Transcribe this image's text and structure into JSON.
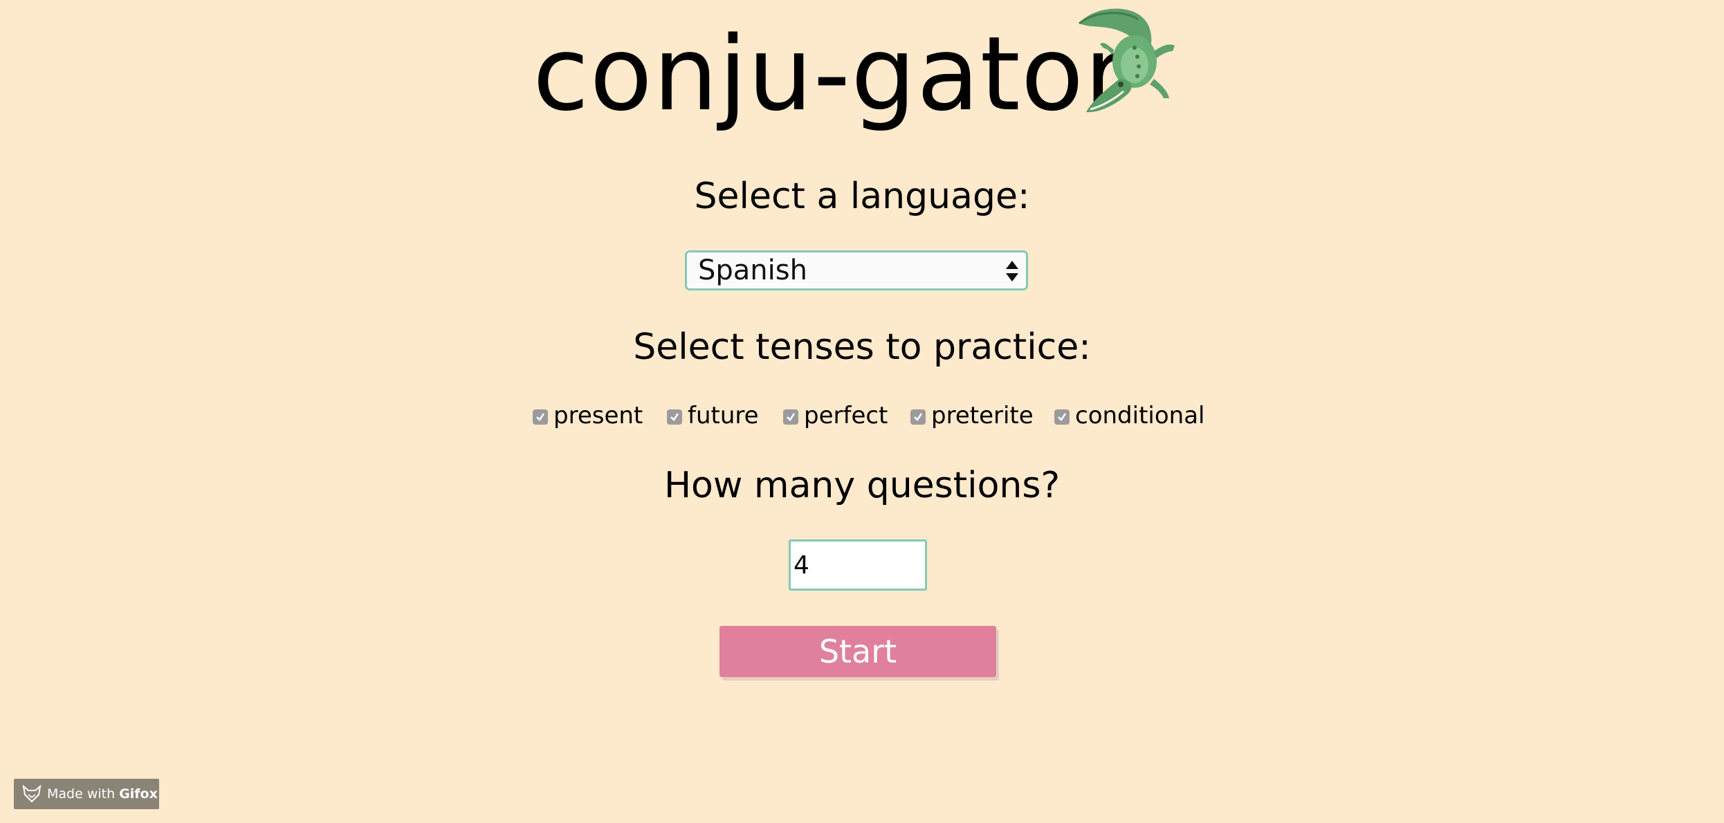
{
  "header": {
    "title": "conju-gator",
    "mascot_icon": "alligator-icon"
  },
  "language": {
    "heading": "Select a language:",
    "selected": "Spanish"
  },
  "tenses": {
    "heading": "Select tenses to practice:",
    "items": [
      {
        "label": "present",
        "checked": true
      },
      {
        "label": "future",
        "checked": true
      },
      {
        "label": "perfect",
        "checked": true
      },
      {
        "label": "preterite",
        "checked": true
      },
      {
        "label": "conditional",
        "checked": true
      }
    ]
  },
  "questions": {
    "heading": "How many questions?",
    "value": "4"
  },
  "start": {
    "label": "Start"
  },
  "badge": {
    "prefix": "Made with ",
    "brand": "Gifox"
  },
  "colors": {
    "background": "#fde9cc",
    "accent_border": "#86c9b4",
    "start_button": "#e0809c",
    "badge": "#8a8477"
  }
}
